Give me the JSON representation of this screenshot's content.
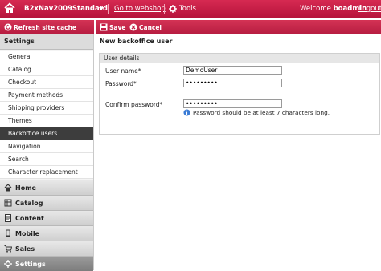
{
  "topbar": {
    "site_name": "B2xNav2009Standard",
    "goto_webshop": "Go to webshop",
    "tools": "Tools",
    "welcome_prefix": "Welcome ",
    "user": "boadmin",
    "logout": "Logout"
  },
  "toolbar": {
    "refresh": "Refresh site cache",
    "save": "Save",
    "cancel": "Cancel"
  },
  "sidebar": {
    "header": "Settings",
    "items": [
      {
        "label": "General"
      },
      {
        "label": "Catalog"
      },
      {
        "label": "Checkout"
      },
      {
        "label": "Payment methods"
      },
      {
        "label": "Shipping providers"
      },
      {
        "label": "Themes"
      },
      {
        "label": "Backoffice users"
      },
      {
        "label": "Navigation"
      },
      {
        "label": "Search"
      },
      {
        "label": "Character replacement rules"
      }
    ],
    "active_item": "Backoffice users",
    "sections": [
      {
        "label": "Home",
        "icon": "home-icon"
      },
      {
        "label": "Catalog",
        "icon": "catalog-icon"
      },
      {
        "label": "Content",
        "icon": "content-icon"
      },
      {
        "label": "Mobile",
        "icon": "mobile-icon"
      },
      {
        "label": "Sales",
        "icon": "sales-icon"
      },
      {
        "label": "Settings",
        "icon": "gear-icon"
      }
    ],
    "active_section": "Settings"
  },
  "main": {
    "title": "New backoffice user",
    "fieldset_legend": "User details",
    "username_label": "User name*",
    "username_value": "DemoUser",
    "password_label": "Password*",
    "password_value": "•••••••••",
    "password_hint": "Password should be at least 7 characters long.",
    "confirm_label": "Confirm password*",
    "confirm_value": "•••••••••"
  },
  "colors": {
    "brand_red": "#c41f47",
    "active_dark": "#3d3d3d"
  }
}
